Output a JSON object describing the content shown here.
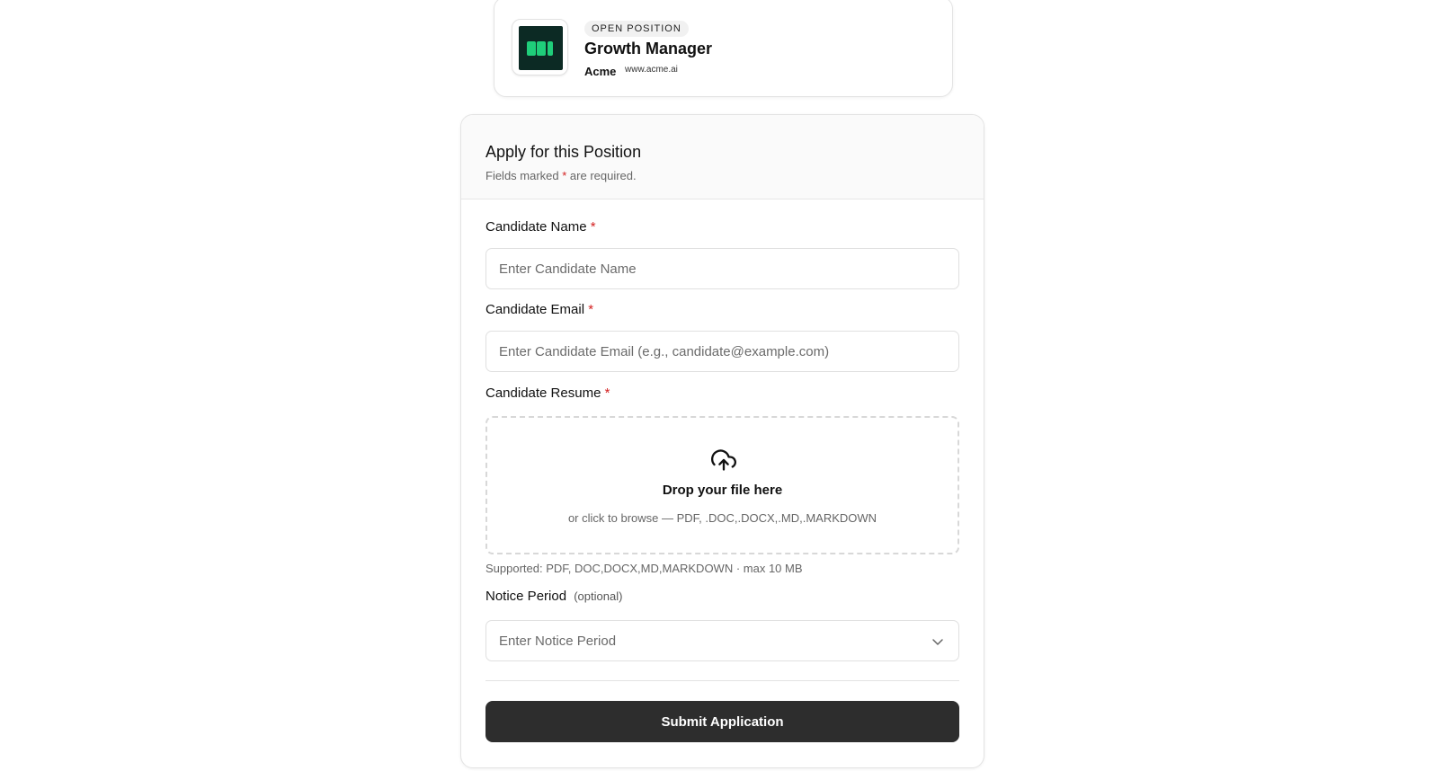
{
  "job": {
    "badge": "OPEN POSITION",
    "title": "Growth Manager",
    "company": "Acme",
    "url": "www.acme.ai"
  },
  "form": {
    "title": "Apply for this Position",
    "subtitle_prefix": "Fields marked ",
    "required_marker": "*",
    "subtitle_suffix": " are required.",
    "fields": {
      "name": {
        "label": "Candidate Name",
        "placeholder": "Enter Candidate Name"
      },
      "email": {
        "label": "Candidate Email",
        "placeholder": "Enter Candidate Email (e.g., candidate@example.com)"
      },
      "resume": {
        "label": "Candidate Resume",
        "drop_title": "Drop your file here",
        "drop_sub": "or click to browse — PDF, .DOC,.DOCX,.MD,.MARKDOWN",
        "supported": "Supported: PDF, DOC,DOCX,MD,MARKDOWN · max 10 MB"
      },
      "notice": {
        "label": "Notice Period",
        "optional": "(optional)",
        "placeholder": "Enter Notice Period"
      }
    },
    "submit_label": "Submit Application"
  },
  "colors": {
    "brand_dark": "#0c2a24",
    "brand_accent": "#1fce7a",
    "required": "#d32020",
    "button_bg": "#2d2d2d"
  },
  "icons": [
    "company-logo-icon",
    "upload-cloud-icon",
    "chevron-down-icon"
  ]
}
